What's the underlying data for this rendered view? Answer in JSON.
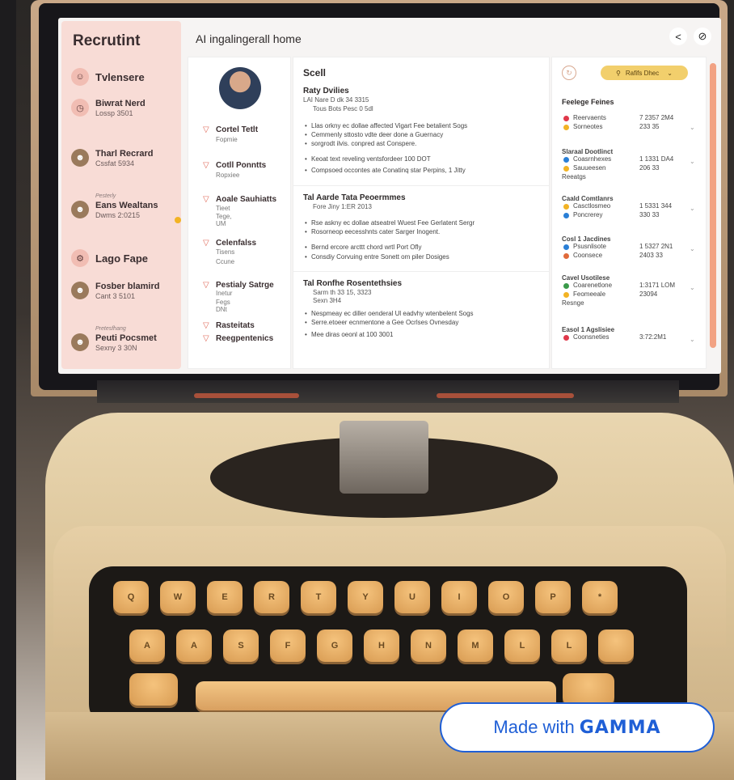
{
  "app": {
    "brand": "Recrutint",
    "header_title": "AI ingalingerall home",
    "header_buttons": [
      "<",
      "⊘"
    ]
  },
  "sidebar": {
    "items": [
      {
        "icon": "person-icon",
        "title": "Tvlensere",
        "sub": "",
        "pre": ""
      },
      {
        "icon": "clock-icon",
        "title": "Biwrat Nerd",
        "sub": "Lossp 3501",
        "pre": ""
      },
      {
        "icon": "avatar",
        "title": "Tharl Recrard",
        "sub": "Cssfat 5934",
        "pre": ""
      },
      {
        "icon": "avatar",
        "title": "Eans Wealtans",
        "sub": "Dwms 2:0215",
        "pre": "Pesterly"
      },
      {
        "icon": "gear-icon",
        "title": "Lago Fape",
        "sub": "",
        "pre": ""
      },
      {
        "icon": "avatar",
        "title": "Fosber blamird",
        "sub": "Cant 3 5101",
        "pre": ""
      },
      {
        "icon": "avatar",
        "title": "Peuti Pocsmet",
        "sub": "Sexny 3 30N",
        "pre": "Pretesfhang"
      }
    ]
  },
  "left_panel": {
    "sections": [
      {
        "title": "Cortel Tetlt",
        "sub": "Fopmie"
      },
      {
        "title": "Cotll Ponntts",
        "sub": "Ropxiee"
      },
      {
        "title": "Aoale Sauhiatts",
        "sub": "Tieet",
        "sub2": "Tege, UM"
      },
      {
        "title": "Celenfalss",
        "sub": "Tisens",
        "sub2": "Ccune"
      },
      {
        "title": "Pestialy Satrge",
        "sub": "Inetur",
        "sub2": "Fegs DNt"
      },
      {
        "title": "Rasteitats",
        "sub": ""
      },
      {
        "title": "Reegpentenics",
        "sub": ""
      }
    ]
  },
  "middle_panel": {
    "heading": "Scell",
    "block1": {
      "title": "Raty Dvilies",
      "meta1": "LAI Nare D dk 34 3315",
      "meta2": "Tous Bots Pesc 0 5dl",
      "bullets": [
        "Llas orkny ec dollae affected Vigart Fee betalient Sogs",
        "Cemmenly sttosto vdte deer done a Guernacy",
        "sorgrodt ilvis. conpred ast Conspere.",
        "Keoat text reveling ventsfordeer 100 DOT",
        "Compsoed occontes ate Conatinq star Perpins, 1 Jitty"
      ]
    },
    "block2": {
      "title": "Tal Aarde Tata Peoermmes",
      "meta1": "Fore Jiny 1:ER 2013",
      "bullets": [
        "Rse askny ec dollae atseatrel Wuest Fee Gerlatent Sergr",
        "Rosorneop eecesshnts cater Sarger Inogent.",
        "Bernd ercore arcttt chord wrtl Port Ofly",
        "Consdiy Corvuing entre Sonett om piler Dosiges"
      ]
    },
    "block3": {
      "title": "Tal Ronfhe Rosentethsies",
      "meta1": "Sarm th 33 15, 3323",
      "meta2": "Sexn 3H4",
      "bullets": [
        "Nespmeay ec diller oenderal Ul eadvhy wtenbelent Sogs",
        "Serre.etoeer ecnmentone a Gee Ocrlses Ovnesday",
        "Mee diras oeonl at 100 3001"
      ]
    }
  },
  "right_panel": {
    "button_label": "Rafifs Dhec",
    "title": "Feelege Feines",
    "groups": [
      {
        "heading": "",
        "rows": [
          {
            "color": "#e0384a",
            "name": "Reervaents",
            "value": "7 2357 2M4"
          },
          {
            "color": "#f2b324",
            "name": "Sorneotes",
            "value": "233 35"
          }
        ]
      },
      {
        "heading": "Slaraal Dootlinct",
        "rows": [
          {
            "color": "#2a7fd6",
            "name": "Coasrnhexes",
            "value": "1 1331 DA4"
          },
          {
            "color": "#f2b324",
            "name": "Sauueesen",
            "value": "206 33"
          }
        ],
        "foot": "Reeatgs"
      },
      {
        "heading": "Caald Comtlanrs",
        "rows": [
          {
            "color": "#f2b324",
            "name": "Casctlosmeo",
            "value": "1 5331 344"
          },
          {
            "color": "#2a7fd6",
            "name": "Poncrerey",
            "value": "330 33"
          }
        ]
      },
      {
        "heading": "Cosl 1 Jacdines",
        "rows": [
          {
            "color": "#2a7fd6",
            "name": "Psusnlisote",
            "value": "1 5327 2N1"
          },
          {
            "color": "#e06a3a",
            "name": "Coonsece",
            "value": "2403 33"
          }
        ]
      },
      {
        "heading": "Cavel Usotilese",
        "rows": [
          {
            "color": "#3a9a4a",
            "name": "Coarenetlone",
            "value": "1:3171 LOM"
          },
          {
            "color": "#f2b324",
            "name": "Feomeeale",
            "value": "23094"
          }
        ],
        "foot": "Resnge"
      },
      {
        "heading": "Easol 1 Agslisiee",
        "rows": [
          {
            "color": "#e0384a",
            "name": "Coonsneties",
            "value": "3:72:2M1"
          }
        ]
      }
    ]
  },
  "keyboard": {
    "row1": [
      "Q",
      "W",
      "E",
      "R",
      "T",
      "Y",
      "U",
      "I",
      "O",
      "P",
      "*"
    ],
    "row2": [
      "A",
      "A",
      "S",
      "F",
      "G",
      "H",
      "N",
      "M",
      "L",
      "L",
      ""
    ]
  },
  "badge": {
    "prefix": "Made with",
    "brand": "GAMMA"
  }
}
